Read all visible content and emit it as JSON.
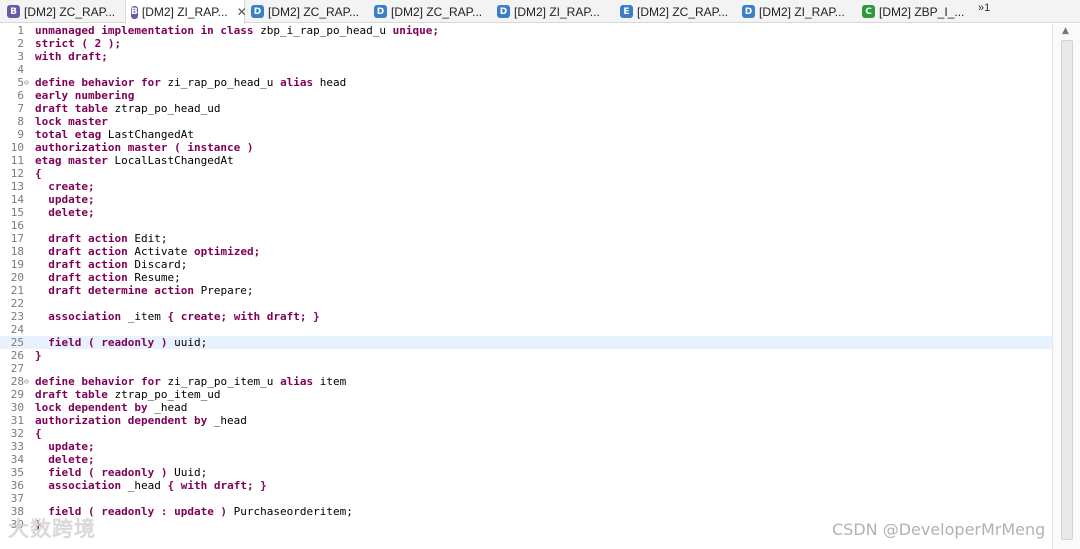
{
  "tabs": [
    {
      "icon": "behavior-definition-icon",
      "letter": "B",
      "color": "#6b5aa6",
      "label": "[DM2] ZC_RAP...",
      "active": false
    },
    {
      "icon": "behavior-definition-icon",
      "letter": "B",
      "color": "#6b5aa6",
      "label": "[DM2] ZI_RAP...",
      "active": true,
      "close": "✕"
    },
    {
      "icon": "data-definition-icon",
      "letter": "D",
      "color": "#3b7fc4",
      "label": "[DM2] ZC_RAP...",
      "active": false
    },
    {
      "icon": "data-definition-icon",
      "letter": "D",
      "color": "#3b7fc4",
      "label": "[DM2] ZC_RAP...",
      "active": false
    },
    {
      "icon": "data-definition-icon",
      "letter": "D",
      "color": "#3b7fc4",
      "label": "[DM2] ZI_RAP...",
      "active": false
    },
    {
      "icon": "metadata-extension-icon",
      "letter": "E",
      "color": "#3b7fc4",
      "label": "[DM2] ZC_RAP...",
      "active": false
    },
    {
      "icon": "data-definition-icon",
      "letter": "D",
      "color": "#3b7fc4",
      "label": "[DM2] ZI_RAP...",
      "active": false
    },
    {
      "icon": "class-icon",
      "letter": "C",
      "color": "#2e9a3c",
      "label": "[DM2] ZBP_I_...",
      "active": false
    }
  ],
  "overflow": {
    "label": "»1"
  },
  "editor": {
    "current_line": 25,
    "lines": [
      {
        "n": "1",
        "t": [
          [
            "k",
            "unmanaged implementation in class"
          ],
          [
            "t",
            " zbp_i_rap_po_head_u "
          ],
          [
            "k",
            "unique;"
          ]
        ]
      },
      {
        "n": "2",
        "t": [
          [
            "k",
            "strict ( 2 );"
          ]
        ]
      },
      {
        "n": "3",
        "t": [
          [
            "k",
            "with draft;"
          ]
        ]
      },
      {
        "n": "4",
        "t": []
      },
      {
        "n": "5",
        "fold": true,
        "t": [
          [
            "k",
            "define behavior for"
          ],
          [
            "t",
            " zi_rap_po_head_u "
          ],
          [
            "k",
            "alias"
          ],
          [
            "t",
            " head"
          ]
        ]
      },
      {
        "n": "6",
        "t": [
          [
            "k",
            "early numbering"
          ]
        ]
      },
      {
        "n": "7",
        "t": [
          [
            "k",
            "draft table"
          ],
          [
            "t",
            " ztrap_po_head_ud"
          ]
        ]
      },
      {
        "n": "8",
        "t": [
          [
            "k",
            "lock master"
          ]
        ]
      },
      {
        "n": "9",
        "t": [
          [
            "k",
            "total etag"
          ],
          [
            "t",
            " LastChangedAt"
          ]
        ]
      },
      {
        "n": "10",
        "t": [
          [
            "k",
            "authorization master ( instance )"
          ]
        ]
      },
      {
        "n": "11",
        "t": [
          [
            "k",
            "etag master"
          ],
          [
            "t",
            " LocalLastChangedAt"
          ]
        ]
      },
      {
        "n": "12",
        "t": [
          [
            "k",
            "{"
          ]
        ]
      },
      {
        "n": "13",
        "t": [
          [
            "t",
            "  "
          ],
          [
            "k",
            "create;"
          ]
        ]
      },
      {
        "n": "14",
        "t": [
          [
            "t",
            "  "
          ],
          [
            "k",
            "update;"
          ]
        ]
      },
      {
        "n": "15",
        "t": [
          [
            "t",
            "  "
          ],
          [
            "k",
            "delete;"
          ]
        ]
      },
      {
        "n": "16",
        "t": []
      },
      {
        "n": "17",
        "t": [
          [
            "t",
            "  "
          ],
          [
            "k",
            "draft action"
          ],
          [
            "t",
            " Edit;"
          ]
        ]
      },
      {
        "n": "18",
        "t": [
          [
            "t",
            "  "
          ],
          [
            "k",
            "draft action"
          ],
          [
            "t",
            " Activate "
          ],
          [
            "k",
            "optimized;"
          ]
        ]
      },
      {
        "n": "19",
        "t": [
          [
            "t",
            "  "
          ],
          [
            "k",
            "draft action"
          ],
          [
            "t",
            " Discard;"
          ]
        ]
      },
      {
        "n": "20",
        "t": [
          [
            "t",
            "  "
          ],
          [
            "k",
            "draft action"
          ],
          [
            "t",
            " Resume;"
          ]
        ]
      },
      {
        "n": "21",
        "t": [
          [
            "t",
            "  "
          ],
          [
            "k",
            "draft determine action"
          ],
          [
            "t",
            " Prepare;"
          ]
        ]
      },
      {
        "n": "22",
        "t": []
      },
      {
        "n": "23",
        "t": [
          [
            "t",
            "  "
          ],
          [
            "k",
            "association"
          ],
          [
            "t",
            " _item "
          ],
          [
            "k",
            "{ create; with draft; }"
          ]
        ]
      },
      {
        "n": "24",
        "t": []
      },
      {
        "n": "25",
        "t": [
          [
            "t",
            "  "
          ],
          [
            "k",
            "field ( readonly )"
          ],
          [
            "t",
            " uuid;"
          ]
        ]
      },
      {
        "n": "26",
        "t": [
          [
            "k",
            "}"
          ]
        ]
      },
      {
        "n": "27",
        "t": []
      },
      {
        "n": "28",
        "fold": true,
        "t": [
          [
            "k",
            "define behavior for"
          ],
          [
            "t",
            " zi_rap_po_item_u "
          ],
          [
            "k",
            "alias"
          ],
          [
            "t",
            " item"
          ]
        ]
      },
      {
        "n": "29",
        "t": [
          [
            "k",
            "draft table"
          ],
          [
            "t",
            " ztrap_po_item_ud"
          ]
        ]
      },
      {
        "n": "30",
        "t": [
          [
            "k",
            "lock dependent by"
          ],
          [
            "t",
            " _head"
          ]
        ]
      },
      {
        "n": "31",
        "t": [
          [
            "k",
            "authorization dependent by"
          ],
          [
            "t",
            " _head"
          ]
        ]
      },
      {
        "n": "32",
        "t": [
          [
            "k",
            "{"
          ]
        ]
      },
      {
        "n": "33",
        "t": [
          [
            "t",
            "  "
          ],
          [
            "k",
            "update;"
          ]
        ]
      },
      {
        "n": "34",
        "t": [
          [
            "t",
            "  "
          ],
          [
            "k",
            "delete;"
          ]
        ]
      },
      {
        "n": "35",
        "t": [
          [
            "t",
            "  "
          ],
          [
            "k",
            "field ( readonly )"
          ],
          [
            "t",
            " Uuid;"
          ]
        ]
      },
      {
        "n": "36",
        "t": [
          [
            "t",
            "  "
          ],
          [
            "k",
            "association"
          ],
          [
            "t",
            " _head "
          ],
          [
            "k",
            "{ with draft; }"
          ]
        ]
      },
      {
        "n": "37",
        "t": []
      },
      {
        "n": "38",
        "t": [
          [
            "t",
            "  "
          ],
          [
            "k",
            "field ( readonly : update )"
          ],
          [
            "t",
            " Purchaseorderitem;"
          ]
        ]
      },
      {
        "n": "39",
        "t": [
          [
            "k",
            "}"
          ]
        ]
      }
    ]
  },
  "watermarks": {
    "left": "大数跨境",
    "right": "CSDN @DeveloperMrMeng"
  }
}
